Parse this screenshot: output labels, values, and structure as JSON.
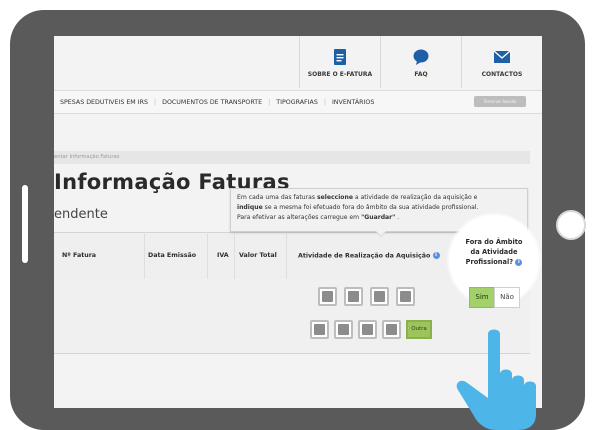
{
  "topnav": [
    {
      "label": "SOBRE O E-FATURA",
      "icon": "document-icon"
    },
    {
      "label": "FAQ",
      "icon": "speech-bubble-icon"
    },
    {
      "label": "CONTACTOS",
      "icon": "envelope-icon"
    }
  ],
  "menu": {
    "items": [
      "SPESAS DEDUTIVEIS EM IRS",
      "DOCUMENTOS DE TRANSPORTE",
      "TIPOGRAFIAS",
      "INVENTÁRIOS"
    ],
    "session_button": "Terminar Sessão"
  },
  "breadcrumb": "entar Informação Faturas",
  "page_title": "Informação Faturas",
  "subtitle": "endente",
  "tooltip": {
    "line1_a": "Em cada uma das faturas ",
    "line1_b": "seleccione",
    "line1_c": " a atividade de realização da aquisição e",
    "line2_a": "indique",
    "line2_b": " se a mesma foi efetuado fora do âmbito da sua atividade profissional.",
    "line3_a": "Para efetivar as alterações carregue em ",
    "line3_b": "\"Guardar\"",
    "line3_c": " ."
  },
  "table": {
    "headers": [
      "Nº Fatura",
      "Data Emissão",
      "IVA",
      "Valor Total",
      "Atividade de Realização da Aquisição"
    ],
    "other_button": "Outra"
  },
  "spotlight": {
    "title": "Fora do Âmbito da Atividade Profissional?",
    "yes": "Sim",
    "no": "Não"
  },
  "colors": {
    "accent_green": "#9cc45d",
    "info_blue": "#5b8ee0",
    "hand_blue": "#4db5e8"
  }
}
